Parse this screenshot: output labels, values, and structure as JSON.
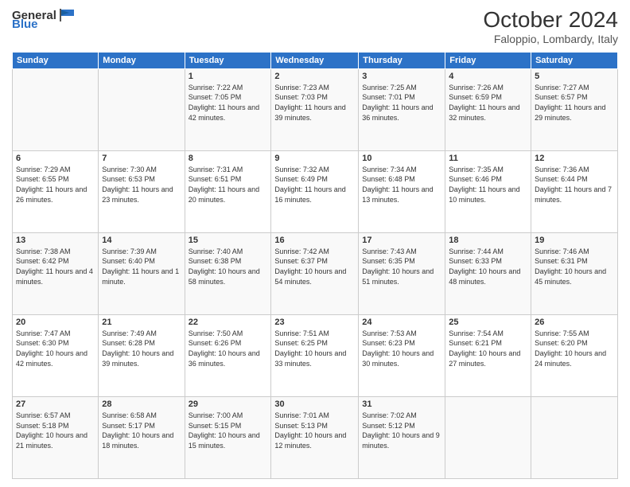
{
  "logo": {
    "general": "General",
    "blue": "Blue"
  },
  "header": {
    "title": "October 2024",
    "subtitle": "Faloppio, Lombardy, Italy"
  },
  "weekdays": [
    "Sunday",
    "Monday",
    "Tuesday",
    "Wednesday",
    "Thursday",
    "Friday",
    "Saturday"
  ],
  "weeks": [
    [
      {
        "day": "",
        "sunrise": "",
        "sunset": "",
        "daylight": ""
      },
      {
        "day": "",
        "sunrise": "",
        "sunset": "",
        "daylight": ""
      },
      {
        "day": "1",
        "sunrise": "Sunrise: 7:22 AM",
        "sunset": "Sunset: 7:05 PM",
        "daylight": "Daylight: 11 hours and 42 minutes."
      },
      {
        "day": "2",
        "sunrise": "Sunrise: 7:23 AM",
        "sunset": "Sunset: 7:03 PM",
        "daylight": "Daylight: 11 hours and 39 minutes."
      },
      {
        "day": "3",
        "sunrise": "Sunrise: 7:25 AM",
        "sunset": "Sunset: 7:01 PM",
        "daylight": "Daylight: 11 hours and 36 minutes."
      },
      {
        "day": "4",
        "sunrise": "Sunrise: 7:26 AM",
        "sunset": "Sunset: 6:59 PM",
        "daylight": "Daylight: 11 hours and 32 minutes."
      },
      {
        "day": "5",
        "sunrise": "Sunrise: 7:27 AM",
        "sunset": "Sunset: 6:57 PM",
        "daylight": "Daylight: 11 hours and 29 minutes."
      }
    ],
    [
      {
        "day": "6",
        "sunrise": "Sunrise: 7:29 AM",
        "sunset": "Sunset: 6:55 PM",
        "daylight": "Daylight: 11 hours and 26 minutes."
      },
      {
        "day": "7",
        "sunrise": "Sunrise: 7:30 AM",
        "sunset": "Sunset: 6:53 PM",
        "daylight": "Daylight: 11 hours and 23 minutes."
      },
      {
        "day": "8",
        "sunrise": "Sunrise: 7:31 AM",
        "sunset": "Sunset: 6:51 PM",
        "daylight": "Daylight: 11 hours and 20 minutes."
      },
      {
        "day": "9",
        "sunrise": "Sunrise: 7:32 AM",
        "sunset": "Sunset: 6:49 PM",
        "daylight": "Daylight: 11 hours and 16 minutes."
      },
      {
        "day": "10",
        "sunrise": "Sunrise: 7:34 AM",
        "sunset": "Sunset: 6:48 PM",
        "daylight": "Daylight: 11 hours and 13 minutes."
      },
      {
        "day": "11",
        "sunrise": "Sunrise: 7:35 AM",
        "sunset": "Sunset: 6:46 PM",
        "daylight": "Daylight: 11 hours and 10 minutes."
      },
      {
        "day": "12",
        "sunrise": "Sunrise: 7:36 AM",
        "sunset": "Sunset: 6:44 PM",
        "daylight": "Daylight: 11 hours and 7 minutes."
      }
    ],
    [
      {
        "day": "13",
        "sunrise": "Sunrise: 7:38 AM",
        "sunset": "Sunset: 6:42 PM",
        "daylight": "Daylight: 11 hours and 4 minutes."
      },
      {
        "day": "14",
        "sunrise": "Sunrise: 7:39 AM",
        "sunset": "Sunset: 6:40 PM",
        "daylight": "Daylight: 11 hours and 1 minute."
      },
      {
        "day": "15",
        "sunrise": "Sunrise: 7:40 AM",
        "sunset": "Sunset: 6:38 PM",
        "daylight": "Daylight: 10 hours and 58 minutes."
      },
      {
        "day": "16",
        "sunrise": "Sunrise: 7:42 AM",
        "sunset": "Sunset: 6:37 PM",
        "daylight": "Daylight: 10 hours and 54 minutes."
      },
      {
        "day": "17",
        "sunrise": "Sunrise: 7:43 AM",
        "sunset": "Sunset: 6:35 PM",
        "daylight": "Daylight: 10 hours and 51 minutes."
      },
      {
        "day": "18",
        "sunrise": "Sunrise: 7:44 AM",
        "sunset": "Sunset: 6:33 PM",
        "daylight": "Daylight: 10 hours and 48 minutes."
      },
      {
        "day": "19",
        "sunrise": "Sunrise: 7:46 AM",
        "sunset": "Sunset: 6:31 PM",
        "daylight": "Daylight: 10 hours and 45 minutes."
      }
    ],
    [
      {
        "day": "20",
        "sunrise": "Sunrise: 7:47 AM",
        "sunset": "Sunset: 6:30 PM",
        "daylight": "Daylight: 10 hours and 42 minutes."
      },
      {
        "day": "21",
        "sunrise": "Sunrise: 7:49 AM",
        "sunset": "Sunset: 6:28 PM",
        "daylight": "Daylight: 10 hours and 39 minutes."
      },
      {
        "day": "22",
        "sunrise": "Sunrise: 7:50 AM",
        "sunset": "Sunset: 6:26 PM",
        "daylight": "Daylight: 10 hours and 36 minutes."
      },
      {
        "day": "23",
        "sunrise": "Sunrise: 7:51 AM",
        "sunset": "Sunset: 6:25 PM",
        "daylight": "Daylight: 10 hours and 33 minutes."
      },
      {
        "day": "24",
        "sunrise": "Sunrise: 7:53 AM",
        "sunset": "Sunset: 6:23 PM",
        "daylight": "Daylight: 10 hours and 30 minutes."
      },
      {
        "day": "25",
        "sunrise": "Sunrise: 7:54 AM",
        "sunset": "Sunset: 6:21 PM",
        "daylight": "Daylight: 10 hours and 27 minutes."
      },
      {
        "day": "26",
        "sunrise": "Sunrise: 7:55 AM",
        "sunset": "Sunset: 6:20 PM",
        "daylight": "Daylight: 10 hours and 24 minutes."
      }
    ],
    [
      {
        "day": "27",
        "sunrise": "Sunrise: 6:57 AM",
        "sunset": "Sunset: 5:18 PM",
        "daylight": "Daylight: 10 hours and 21 minutes."
      },
      {
        "day": "28",
        "sunrise": "Sunrise: 6:58 AM",
        "sunset": "Sunset: 5:17 PM",
        "daylight": "Daylight: 10 hours and 18 minutes."
      },
      {
        "day": "29",
        "sunrise": "Sunrise: 7:00 AM",
        "sunset": "Sunset: 5:15 PM",
        "daylight": "Daylight: 10 hours and 15 minutes."
      },
      {
        "day": "30",
        "sunrise": "Sunrise: 7:01 AM",
        "sunset": "Sunset: 5:13 PM",
        "daylight": "Daylight: 10 hours and 12 minutes."
      },
      {
        "day": "31",
        "sunrise": "Sunrise: 7:02 AM",
        "sunset": "Sunset: 5:12 PM",
        "daylight": "Daylight: 10 hours and 9 minutes."
      },
      {
        "day": "",
        "sunrise": "",
        "sunset": "",
        "daylight": ""
      },
      {
        "day": "",
        "sunrise": "",
        "sunset": "",
        "daylight": ""
      }
    ]
  ]
}
